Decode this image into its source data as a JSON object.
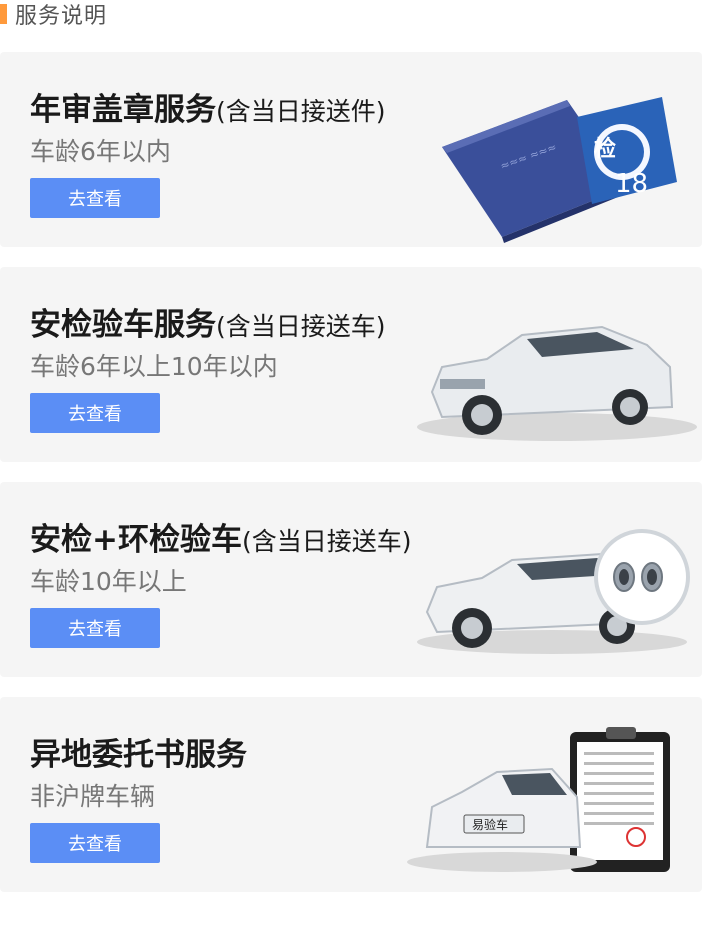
{
  "header": {
    "title": "服务说明",
    "accent": "#ff9a3c"
  },
  "cards": [
    {
      "title": "年审盖章服务",
      "subtitle": "(含当日接送件)",
      "desc": "车龄6年以内",
      "button": "去查看",
      "sticker_number": "18",
      "sticker_badge": "检"
    },
    {
      "title": "安检验车服务",
      "subtitle": "(含当日接送车)",
      "desc": "车龄6年以上10年以内",
      "button": "去查看"
    },
    {
      "title": "安检+环检验车",
      "subtitle": "(含当日接送车)",
      "desc": "车龄10年以上",
      "button": "去查看"
    },
    {
      "title": "异地委托书服务",
      "subtitle": "",
      "desc": "非沪牌车辆",
      "button": "去查看",
      "plate_text": "易验车"
    }
  ],
  "colors": {
    "button": "#5b8ef5",
    "card_bg": "#f5f5f5"
  }
}
